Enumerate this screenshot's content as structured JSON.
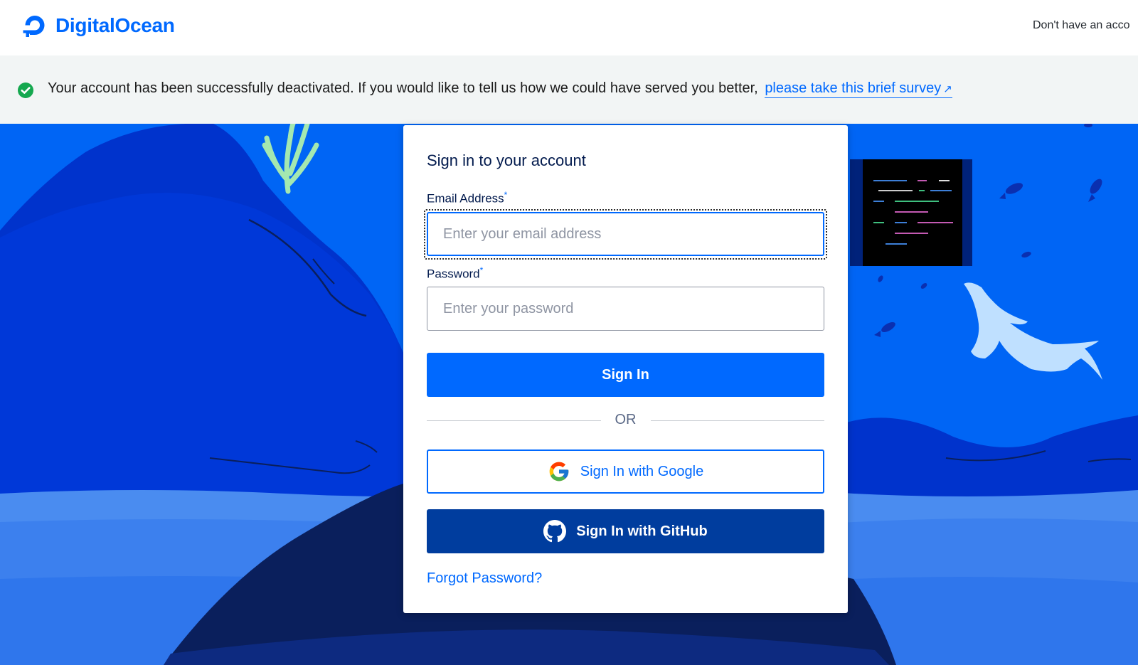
{
  "header": {
    "brand": "DigitalOcean",
    "signup_prompt": "Don't have an acco"
  },
  "banner": {
    "message": "Your account has been successfully deactivated. If you would like to tell us how we could have served you better,",
    "link_label": "please take this brief survey",
    "link_icon": "external-arrow-icon",
    "status_color": "#15a84f"
  },
  "signin": {
    "title": "Sign in to your account",
    "email_label": "Email Address",
    "email_placeholder": "Enter your email address",
    "email_value": "",
    "password_label": "Password",
    "password_placeholder": "Enter your password",
    "password_value": "",
    "required_mark": "*",
    "submit_label": "Sign In",
    "divider_label": "OR",
    "google_label": "Sign In with Google",
    "github_label": "Sign In with GitHub",
    "forgot_label": "Forgot Password?"
  },
  "colors": {
    "accent": "#0069ff",
    "github_button": "#003d9e",
    "ocean": "#0065f5"
  }
}
